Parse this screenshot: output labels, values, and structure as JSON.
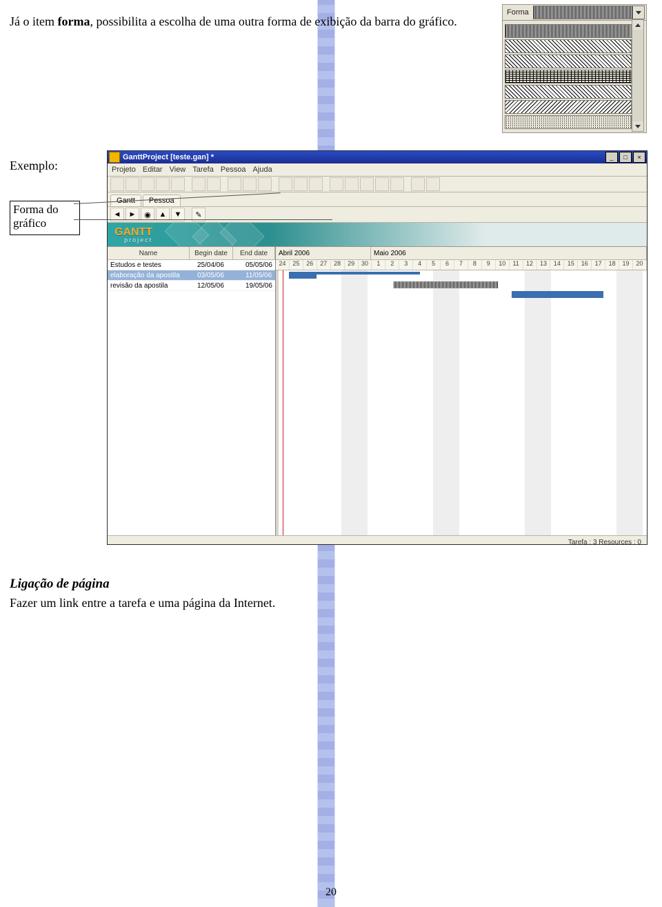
{
  "doc": {
    "intro_pre": "Já o item ",
    "intro_bold": "forma",
    "intro_post": ", possibilita a escolha de uma outra forma de exibição da barra do gráfico.",
    "exemplo": "Exemplo:",
    "section_title": "Ligação de página",
    "section_text": "Fazer um link entre a tarefa e uma página da Internet.",
    "page_number": "20"
  },
  "forma_panel": {
    "label": "Forma"
  },
  "callout": {
    "text": "Forma do gráfico"
  },
  "app": {
    "title": "GanttProject [teste.gan] *",
    "menu": [
      "Projeto",
      "Editar",
      "View",
      "Tarefa",
      "Pessoa",
      "Ajuda"
    ],
    "tabs": {
      "gantt": "Gantt",
      "pessoa": "Pessoa"
    },
    "table_headers": {
      "name": "Name",
      "begin": "Begin date",
      "end": "End date"
    },
    "tasks": [
      {
        "name": "Estudos e testes",
        "begin": "25/04/06",
        "end": "05/05/06",
        "selected": false
      },
      {
        "name": "elaboração da apostila",
        "begin": "03/05/06",
        "end": "11/05/06",
        "selected": true
      },
      {
        "name": "revisão da apostila",
        "begin": "12/05/06",
        "end": "19/05/06",
        "selected": false
      }
    ],
    "timeline": {
      "months": [
        {
          "label": "Abril 2006",
          "span_days": 7
        },
        {
          "label": "Maio 2006",
          "span_days": 20
        }
      ],
      "days": [
        "24",
        "25",
        "26",
        "27",
        "28",
        "29",
        "30",
        "1",
        "2",
        "3",
        "4",
        "5",
        "6",
        "7",
        "8",
        "9",
        "10",
        "11",
        "12",
        "13",
        "14",
        "15",
        "16",
        "17",
        "18",
        "19",
        "20"
      ]
    },
    "status": "Tarefa : 3 Resources : 0",
    "logo": {
      "top": "GANTT",
      "bottom": "project"
    }
  }
}
